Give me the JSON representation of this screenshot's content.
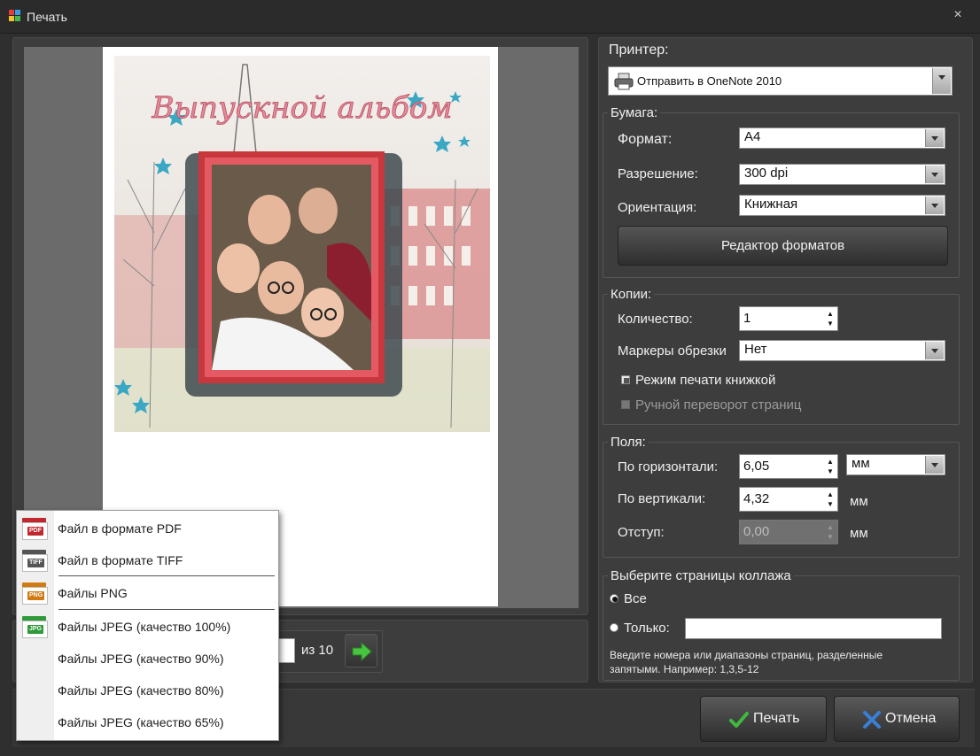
{
  "window": {
    "title": "Печать",
    "close_glyph": "×"
  },
  "preview": {
    "title_art": "Выпускной альбом",
    "page_number": "",
    "page_of": "из 10"
  },
  "printer": {
    "label": "Принтер:",
    "selected": "Отправить в OneNote 2010"
  },
  "paper": {
    "group_title": "Бумага:",
    "format_label": "Формат:",
    "format_value": "A4",
    "resolution_label": "Разрешение:",
    "resolution_value": "300 dpi",
    "orientation_label": "Ориентация:",
    "orientation_value": "Книжная",
    "editor_button": "Редактор форматов"
  },
  "copies": {
    "group_title": "Копии:",
    "count_label": "Количество:",
    "count_value": "1",
    "crop_label": "Маркеры обрезки",
    "crop_value": "Нет",
    "booklet_label": "Режим печати книжкой",
    "manual_flip_label": "Ручной переворот страниц"
  },
  "margins": {
    "group_title": "Поля:",
    "horizontal_label": "По горизонтали:",
    "horizontal_value": "6,05",
    "unit_value": "мм",
    "vertical_label": "По вертикали:",
    "vertical_value": "4,32",
    "vertical_unit": "мм",
    "indent_label": "Отступ:",
    "indent_value": "0,00",
    "indent_unit": "мм"
  },
  "pages": {
    "group_title": "Выберите страницы коллажа",
    "all_label": "Все",
    "only_label": "Только:",
    "only_value": "",
    "hint": "Введите номера или диапазоны страниц, разделенные запятыми. Например: 1,3,5-12"
  },
  "actions": {
    "print": "Печать",
    "cancel": "Отмена"
  },
  "export_menu": {
    "items": [
      {
        "label": "Файл в формате PDF",
        "icon": "pdf-file-icon",
        "tag": "PDF",
        "color": "#c0282d"
      },
      {
        "label": "Файл в формате TIFF",
        "icon": "tiff-file-icon",
        "tag": "TIFF",
        "color": "#555555"
      },
      {
        "label": "Файлы PNG",
        "icon": "png-file-icon",
        "tag": "PNG",
        "color": "#d07a12"
      },
      {
        "label": "Файлы JPEG (качество 100%)",
        "icon": "jpg-file-icon",
        "tag": "JPG",
        "color": "#2e9a3a"
      },
      {
        "label": "Файлы JPEG (качество 90%)"
      },
      {
        "label": "Файлы JPEG (качество 80%)"
      },
      {
        "label": "Файлы JPEG (качество 65%)"
      }
    ]
  },
  "colors": {
    "background": "#2f2f2f",
    "panel": "#3d3d3d",
    "accent_green": "#3fb93f",
    "accent_blue": "#3a7fd6"
  }
}
